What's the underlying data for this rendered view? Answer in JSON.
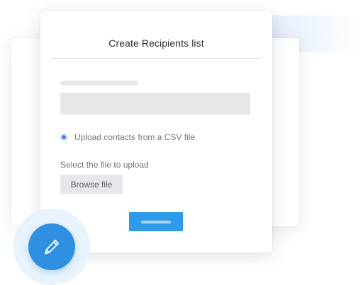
{
  "dialog": {
    "title": "Create Recipients list",
    "radio_option_label": "Upload contacts from a CSV file",
    "radio_selected": true,
    "file_label": "Select the file to upload",
    "browse_button_label": "Browse file"
  },
  "fab": {
    "icon": "pencil-icon"
  },
  "colors": {
    "accent_blue": "#2f9bea",
    "fab_blue": "#2f8fe0",
    "skeleton_gray": "#e6e7ea"
  }
}
